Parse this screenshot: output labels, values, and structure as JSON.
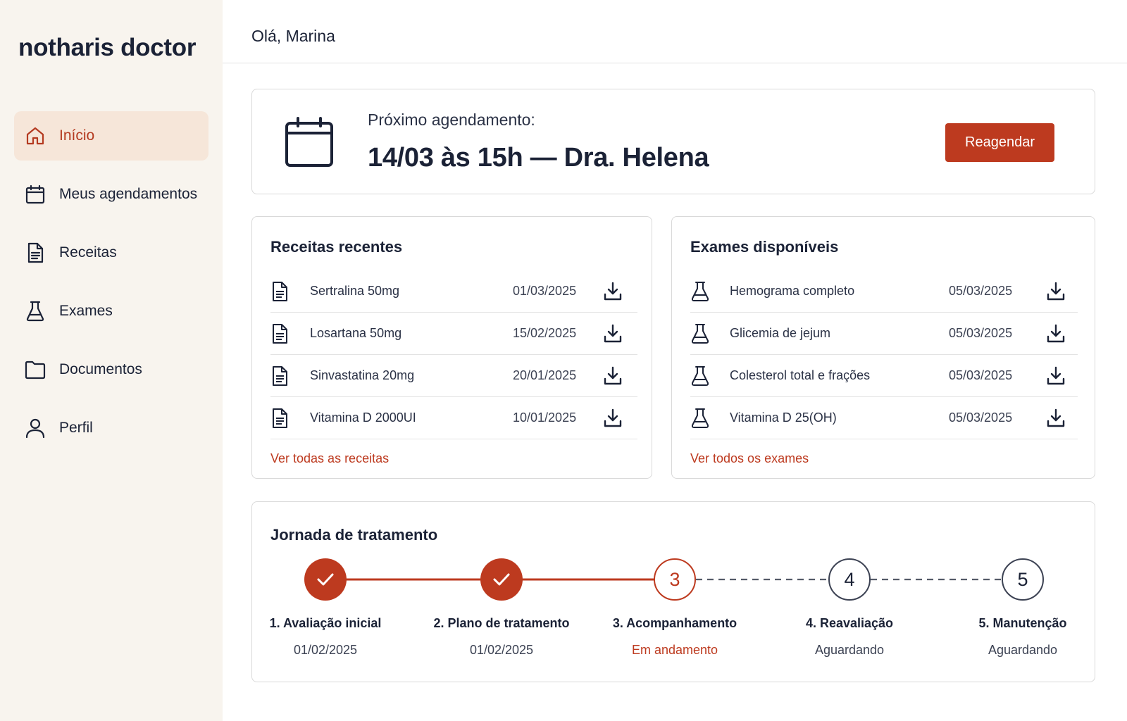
{
  "brand": "notharis doctor",
  "colors": {
    "accent": "#bd3a1f",
    "sidebar_bg": "#f8f4ee",
    "active_bg": "#f6e6d9",
    "text": "#1b2236"
  },
  "sidebar": {
    "items": [
      {
        "label": "Início",
        "icon": "home-icon",
        "active": true
      },
      {
        "label": "Meus agendamentos",
        "icon": "calendar-icon",
        "active": false
      },
      {
        "label": "Receitas",
        "icon": "document-icon",
        "active": false
      },
      {
        "label": "Exames",
        "icon": "flask-icon",
        "active": false
      },
      {
        "label": "Documentos",
        "icon": "folder-icon",
        "active": false
      },
      {
        "label": "Perfil",
        "icon": "user-icon",
        "active": false
      }
    ]
  },
  "header": {
    "greeting": "Olá, Marina"
  },
  "appointment": {
    "label": "Próximo agendamento:",
    "value": "14/03 às 15h — Dra. Helena",
    "button": "Reagendar",
    "icon": "calendar-icon"
  },
  "prescriptions": {
    "title": "Receitas recentes",
    "icon": "document-icon",
    "rows": [
      {
        "name": "Sertralina 50mg",
        "date": "01/03/2025"
      },
      {
        "name": "Losartana 50mg",
        "date": "15/02/2025"
      },
      {
        "name": "Sinvastatina 20mg",
        "date": "20/01/2025"
      },
      {
        "name": "Vitamina D 2000UI",
        "date": "10/01/2025"
      }
    ],
    "link": "Ver todas as receitas"
  },
  "exams": {
    "title": "Exames disponíveis",
    "icon": "flask-icon",
    "rows": [
      {
        "name": "Hemograma completo",
        "date": "05/03/2025"
      },
      {
        "name": "Glicemia de jejum",
        "date": "05/03/2025"
      },
      {
        "name": "Colesterol total e frações",
        "date": "05/03/2025"
      },
      {
        "name": "Vitamina D 25(OH)",
        "date": "05/03/2025"
      }
    ],
    "link": "Ver todos os exames"
  },
  "journey": {
    "title": "Jornada de tratamento",
    "steps": [
      {
        "number": "",
        "label": "1. Avaliação inicial",
        "sub": "01/02/2025",
        "status": "done"
      },
      {
        "number": "",
        "label": "2. Plano de tratamento",
        "sub": "01/02/2025",
        "status": "done"
      },
      {
        "number": "3",
        "label": "3. Acompanhamento",
        "sub": "Em andamento",
        "status": "current"
      },
      {
        "number": "4",
        "label": "4. Reavaliação",
        "sub": "Aguardando",
        "status": "pending"
      },
      {
        "number": "5",
        "label": "5. Manutenção",
        "sub": "Aguardando",
        "status": "pending"
      }
    ]
  }
}
